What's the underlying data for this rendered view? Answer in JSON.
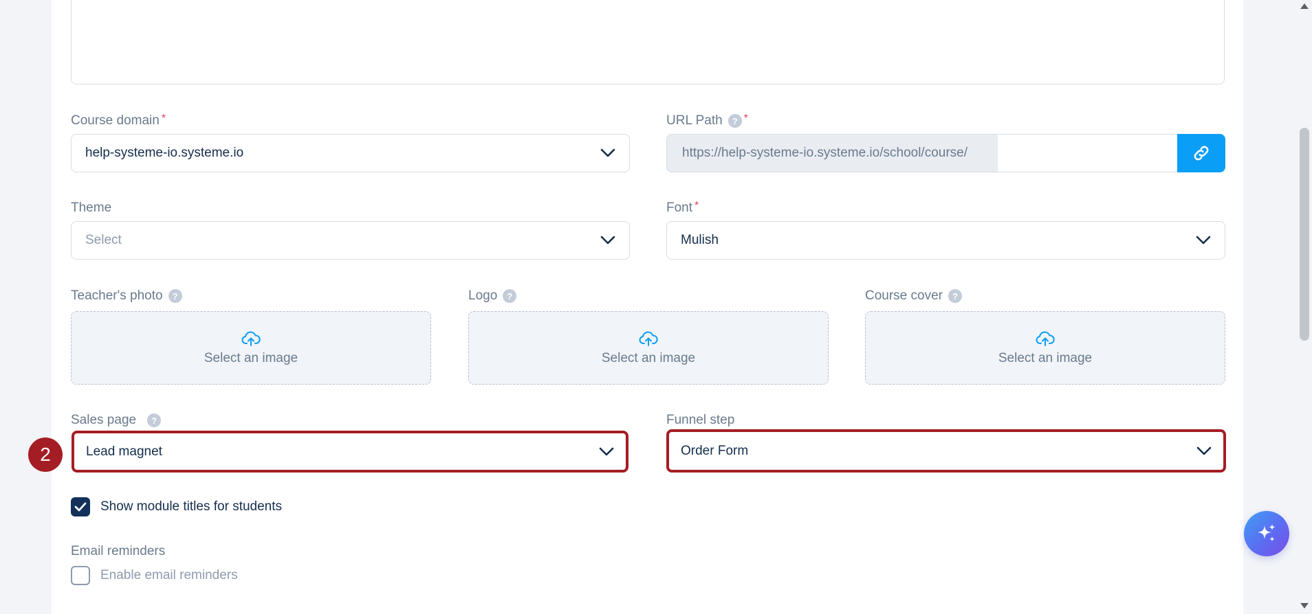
{
  "form": {
    "course_domain": {
      "label": "Course domain",
      "required": "*",
      "value": "help-systeme-io.systeme.io"
    },
    "url_path": {
      "label": "URL Path",
      "help": "?",
      "required": "*",
      "prefix": "https://help-systeme-io.systeme.io/school/course/",
      "value": ""
    },
    "theme": {
      "label": "Theme",
      "placeholder": "Select"
    },
    "font": {
      "label": "Font",
      "required": "*",
      "value": "Mulish"
    },
    "teacher_photo": {
      "label": "Teacher's photo",
      "help": "?",
      "upload_text": "Select an image"
    },
    "logo": {
      "label": "Logo",
      "help": "?",
      "upload_text": "Select an image"
    },
    "course_cover": {
      "label": "Course cover",
      "help": "?",
      "upload_text": "Select an image"
    },
    "sales_page": {
      "label": "Sales page",
      "help": "?",
      "value": "Lead magnet"
    },
    "funnel_step": {
      "label": "Funnel step",
      "value": "Order Form"
    },
    "show_module_titles": {
      "label": "Show module titles for students",
      "checked": true
    },
    "email_reminders": {
      "label": "Email reminders",
      "checkbox_label": "Enable email reminders",
      "checked": false
    }
  },
  "annotation": {
    "step_number": "2",
    "highlight_color": "#a51d24"
  },
  "colors": {
    "accent": "#0a9ef6",
    "text_dark": "#142d4c",
    "text_muted": "#697a8d",
    "required": "#e0435c"
  },
  "icons": {
    "dropdown": "chevron-down-icon",
    "link": "link-icon",
    "upload": "cloud-upload-icon",
    "check": "checkmark-icon",
    "ai": "sparkles-icon"
  }
}
